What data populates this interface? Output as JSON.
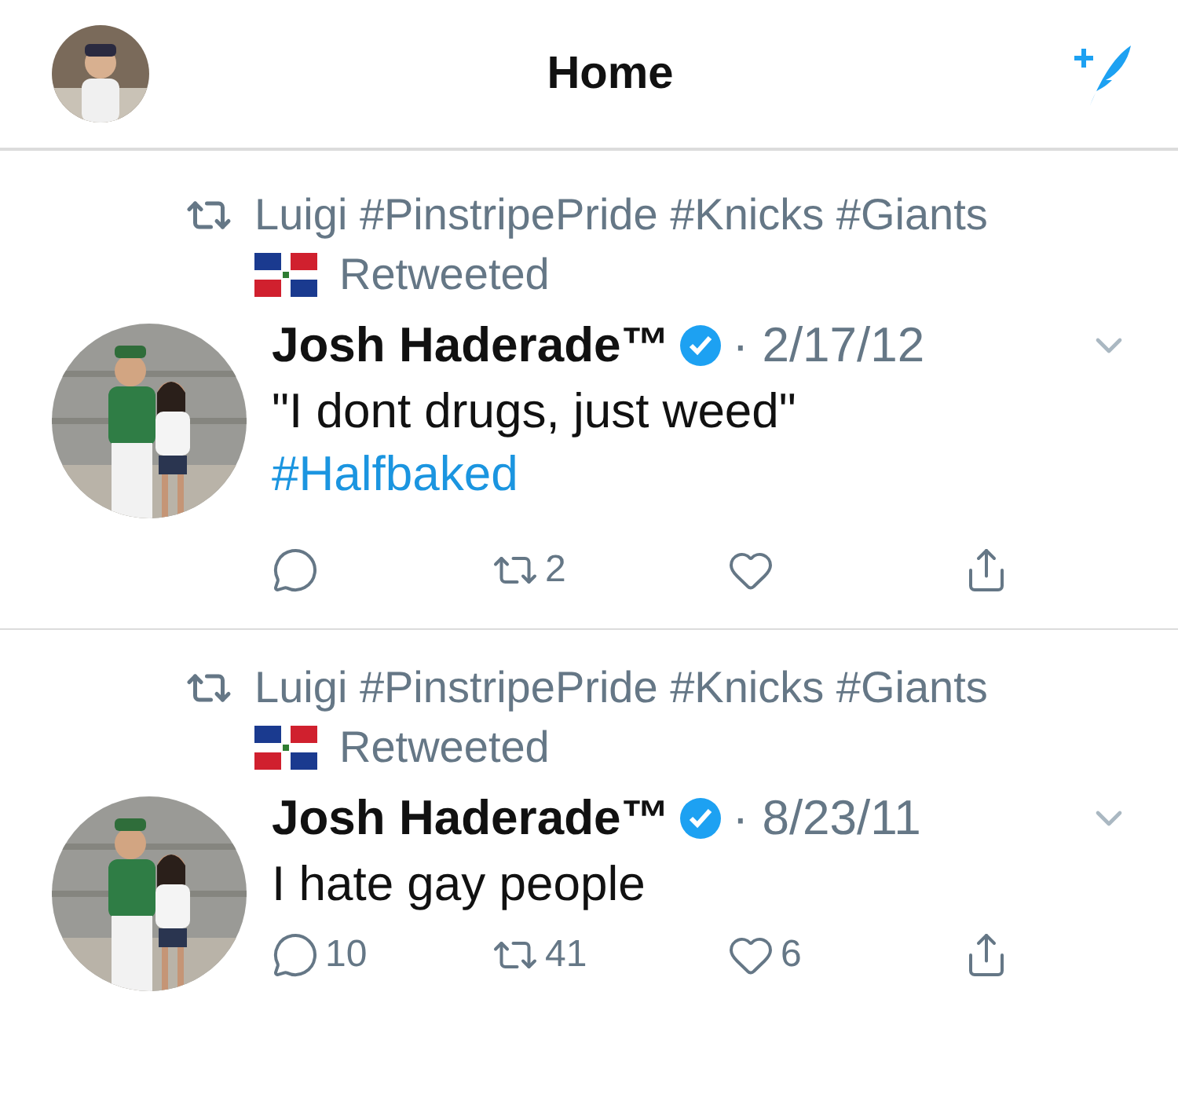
{
  "header": {
    "title": "Home"
  },
  "tweets": [
    {
      "retweeted_by": "Luigi #PinstripePride #Knicks #Giants",
      "retweet_label": "Retweeted",
      "author": "Josh Haderade™",
      "verified": true,
      "date": "· 2/17/12",
      "lines": [
        {
          "kind": "plain",
          "text": "\"I dont drugs, just weed\""
        },
        {
          "kind": "hashtag",
          "text": "#Halfbaked"
        }
      ],
      "actions": [
        {
          "kind": "reply"
        },
        {
          "kind": "retweet",
          "count": "2"
        },
        {
          "kind": "like"
        },
        {
          "kind": "share"
        }
      ]
    },
    {
      "retweeted_by": "Luigi #PinstripePride #Knicks #Giants",
      "retweet_label": "Retweeted",
      "author": "Josh Haderade™",
      "verified": true,
      "date": "· 8/23/11",
      "lines": [
        {
          "kind": "plain",
          "text": "I hate gay people"
        }
      ],
      "actions": [
        {
          "kind": "reply",
          "count": "10"
        },
        {
          "kind": "retweet",
          "count": "41"
        },
        {
          "kind": "like",
          "count": "6"
        },
        {
          "kind": "share"
        }
      ]
    }
  ]
}
